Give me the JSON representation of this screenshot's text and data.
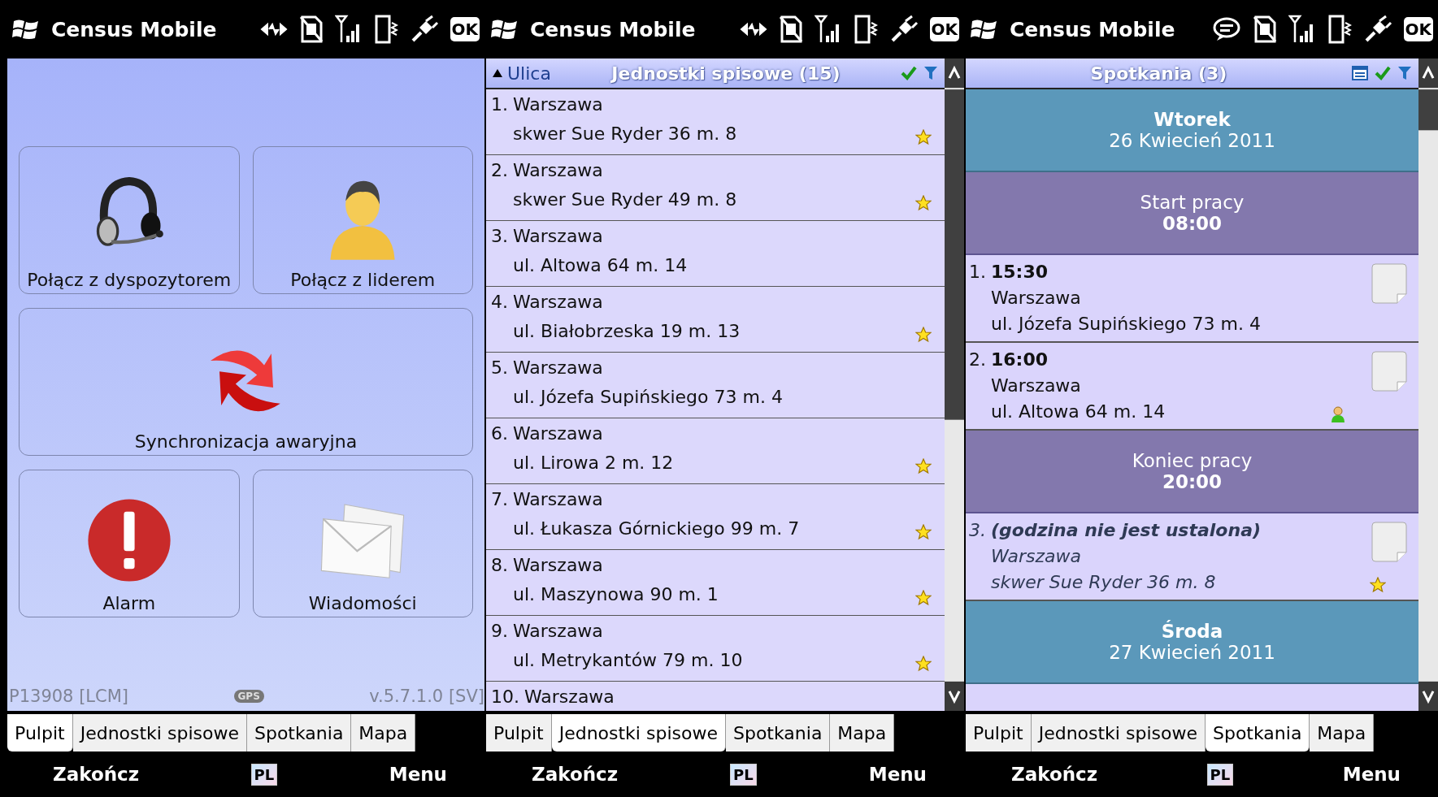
{
  "screens": [
    {
      "kind": "dashboard",
      "status_bar": {
        "title": "Census Mobile",
        "ok": "OK"
      },
      "tiles": [
        {
          "label": "Połącz z dyspozytorem"
        },
        {
          "label": "Połącz z liderem"
        },
        {
          "label": "Synchronizacja awaryjna"
        },
        {
          "label": "Alarm"
        },
        {
          "label": "Wiadomości"
        }
      ],
      "footer": {
        "user": "P13908 [LCM]",
        "gps": "GPS",
        "version": "v.5.7.1.0 [SV]"
      },
      "tabs": [
        {
          "label": "Pulpit",
          "selected": true
        },
        {
          "label": "Jednostki spisowe",
          "selected": false
        },
        {
          "label": "Spotkania",
          "selected": false
        },
        {
          "label": "Mapa",
          "selected": false
        }
      ],
      "softkeys": {
        "left": "Zakończ",
        "lang": "PL",
        "right": "Menu"
      }
    },
    {
      "kind": "list",
      "status_bar": {
        "title": "Census Mobile",
        "ok": "OK"
      },
      "header": {
        "sort": "Ulica",
        "title": "Jednostki spisowe (15)"
      },
      "rows": [
        {
          "number": "1.",
          "city": "Warszawa",
          "address": "skwer Sue Ryder 36 m. 8",
          "starred": true
        },
        {
          "number": "2.",
          "city": "Warszawa",
          "address": "skwer Sue Ryder 49 m. 8",
          "starred": true
        },
        {
          "number": "3.",
          "city": "Warszawa",
          "address": "ul. Altowa 64 m. 14",
          "starred": false
        },
        {
          "number": "4.",
          "city": "Warszawa",
          "address": "ul. Białobrzeska 19 m. 13",
          "starred": true
        },
        {
          "number": "5.",
          "city": "Warszawa",
          "address": "ul. Józefa Supińskiego 73 m. 4",
          "starred": false
        },
        {
          "number": "6.",
          "city": "Warszawa",
          "address": "ul. Lirowa 2 m. 12",
          "starred": true
        },
        {
          "number": "7.",
          "city": "Warszawa",
          "address": "ul. Łukasza Górnickiego 99 m. 7",
          "starred": true
        },
        {
          "number": "8.",
          "city": "Warszawa",
          "address": "ul. Maszynowa 90 m. 1",
          "starred": true
        },
        {
          "number": "9.",
          "city": "Warszawa",
          "address": "ul. Metrykantów 79 m. 10",
          "starred": true
        },
        {
          "number": "10.",
          "city": "Warszawa",
          "starred": false
        }
      ],
      "tabs": [
        {
          "label": "Pulpit",
          "selected": false
        },
        {
          "label": "Jednostki spisowe",
          "selected": true
        },
        {
          "label": "Spotkania",
          "selected": false
        },
        {
          "label": "Mapa",
          "selected": false
        }
      ],
      "softkeys": {
        "left": "Zakończ",
        "lang": "PL",
        "right": "Menu"
      }
    },
    {
      "kind": "agenda",
      "status_bar": {
        "title": "Census Mobile",
        "ok": "OK"
      },
      "header": {
        "title": "Spotkania (3)"
      },
      "items": [
        {
          "kind": "day",
          "title": "Wtorek",
          "date": "26 Kwiecień 2011"
        },
        {
          "kind": "marker",
          "label": "Start pracy",
          "time": "08:00"
        },
        {
          "kind": "appointment",
          "number": "1.",
          "time": "15:30",
          "city": "Warszawa",
          "address": "ul. Józefa Supińskiego 73 m. 4",
          "scheduled": true,
          "assigned": false,
          "starred": false
        },
        {
          "kind": "appointment",
          "number": "2.",
          "time": "16:00",
          "city": "Warszawa",
          "address": "ul. Altowa 64 m. 14",
          "scheduled": true,
          "assigned": true,
          "starred": false
        },
        {
          "kind": "marker",
          "label": "Koniec pracy",
          "time": "20:00"
        },
        {
          "kind": "appointment",
          "number": "3.",
          "time": "(godzina nie jest ustalona)",
          "city": "Warszawa",
          "address": "skwer Sue Ryder 36 m. 8",
          "scheduled": false,
          "assigned": false,
          "starred": true
        },
        {
          "kind": "day",
          "title": "Środa",
          "date": "27 Kwiecień 2011"
        }
      ],
      "tabs": [
        {
          "label": "Pulpit",
          "selected": false
        },
        {
          "label": "Jednostki spisowe",
          "selected": false
        },
        {
          "label": "Spotkania",
          "selected": true
        },
        {
          "label": "Mapa",
          "selected": false
        }
      ],
      "softkeys": {
        "left": "Zakończ",
        "lang": "PL",
        "right": "Menu"
      }
    }
  ]
}
